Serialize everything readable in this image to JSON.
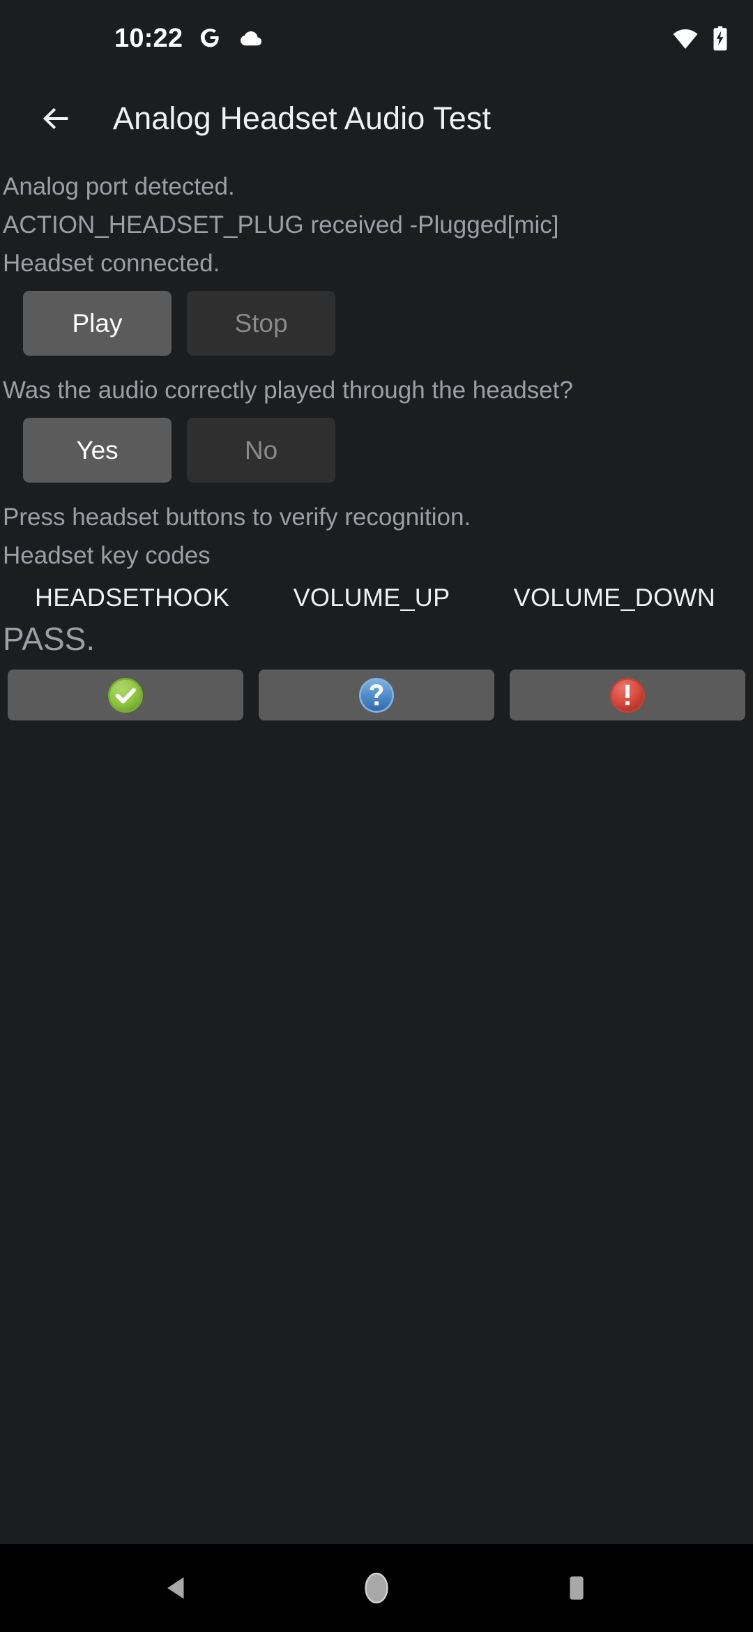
{
  "status_bar": {
    "clock": "10:22",
    "left_icons": [
      {
        "name": "google-icon",
        "glyph": "G"
      },
      {
        "name": "cloud-icon",
        "glyph": "cloud"
      }
    ],
    "right_icons": [
      {
        "name": "wifi-icon",
        "glyph": "wifi-full"
      },
      {
        "name": "battery-charging-icon",
        "glyph": "battery-charging"
      }
    ]
  },
  "app_bar": {
    "back_icon": "arrow-back-icon",
    "title": "Analog Headset Audio Test"
  },
  "content": {
    "status_lines": [
      "Analog port detected.",
      "ACTION_HEADSET_PLUG received -Plugged[mic]",
      "Headset connected."
    ],
    "playback": {
      "play_label": "Play",
      "play_enabled": true,
      "stop_label": "Stop",
      "stop_enabled": false
    },
    "question": "Was the audio correctly played through the headset?",
    "answer": {
      "yes_label": "Yes",
      "yes_enabled": true,
      "no_label": "No",
      "no_enabled": false
    },
    "press_hint": "Press headset buttons to verify recognition.",
    "keycodes_header": "Headset key codes",
    "keycodes": [
      "HEADSETHOOK",
      "VOLUME_UP",
      "VOLUME_DOWN"
    ],
    "verdict": "PASS.",
    "action_buttons": [
      {
        "name": "pass-button",
        "icon": "check-circle-icon",
        "color": "#8cc63e"
      },
      {
        "name": "info-button",
        "icon": "question-circle-icon",
        "color": "#4a86c8"
      },
      {
        "name": "fail-button",
        "icon": "exclamation-circle-icon",
        "color": "#d9483b"
      }
    ]
  },
  "nav_bar": {
    "back_label": "back-icon",
    "home_label": "home-icon",
    "recents_label": "recents-icon"
  },
  "colors": {
    "background": "#1c1d1f",
    "nav_background": "#000000",
    "muted_text": "#9aa0a6",
    "bright_text": "#f1f1f1",
    "button_enabled": "#5b5b5b",
    "button_disabled": "#2f2f2f",
    "pass_green": "#8cc63e",
    "info_blue": "#4a86c8",
    "fail_red": "#d9483b"
  }
}
